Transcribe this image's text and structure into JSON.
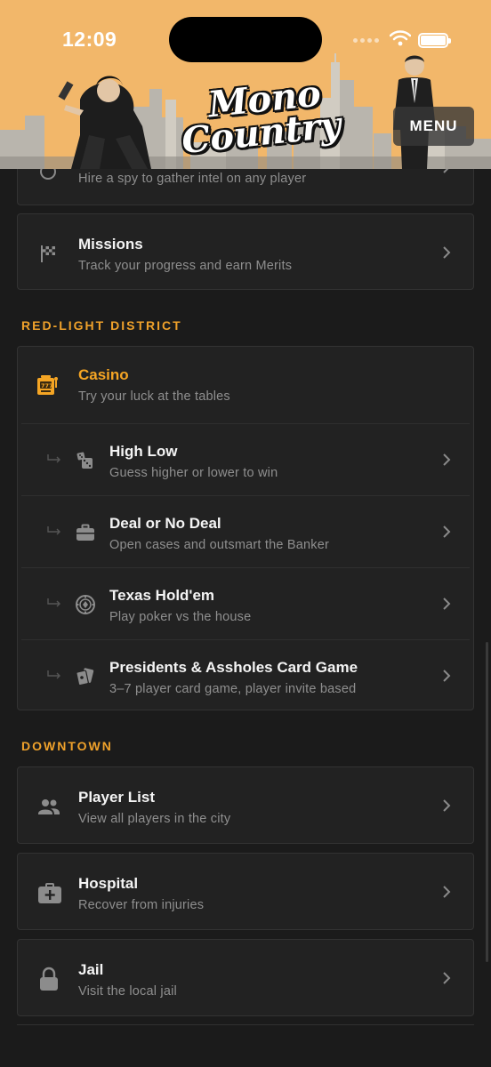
{
  "status": {
    "time": "12:09",
    "battery_level": 1.0
  },
  "header": {
    "logo_line1": "Mono",
    "logo_line2": "Country",
    "menu_label": "MENU"
  },
  "spy": {
    "subtitle": "Hire a spy to gather intel on any player",
    "icon": "spy-icon"
  },
  "missions": {
    "title": "Missions",
    "subtitle": "Track your progress and earn Merits",
    "icon": "checkered-flag-icon"
  },
  "red_light": {
    "section_title": "RED-LIGHT DISTRICT",
    "casino": {
      "title": "Casino",
      "subtitle": "Try your luck at the tables",
      "icon": "slot-machine-icon",
      "accent": "#f5a524"
    },
    "games": [
      {
        "title": "High Low",
        "subtitle": "Guess higher or lower to win",
        "icon": "dice-icon"
      },
      {
        "title": "Deal or No Deal",
        "subtitle": "Open cases and outsmart the Banker",
        "icon": "briefcase-icon"
      },
      {
        "title": "Texas Hold'em",
        "subtitle": "Play poker vs the house",
        "icon": "poker-chip-icon"
      },
      {
        "title": "Presidents & Assholes Card Game",
        "subtitle": "3–7 player card game, player invite based",
        "icon": "playing-cards-icon"
      }
    ]
  },
  "downtown": {
    "section_title": "DOWNTOWN",
    "items": [
      {
        "title": "Player List",
        "subtitle": "View all players in the city",
        "icon": "users-icon"
      },
      {
        "title": "Hospital",
        "subtitle": "Recover from injuries",
        "icon": "medical-kit-icon"
      },
      {
        "title": "Jail",
        "subtitle": "Visit the local jail",
        "icon": "lock-icon"
      }
    ]
  },
  "colors": {
    "accent": "#f0a22b",
    "header_bg": "#f2b76a",
    "page_bg": "#1b1b1b",
    "card_bg": "#222222"
  }
}
